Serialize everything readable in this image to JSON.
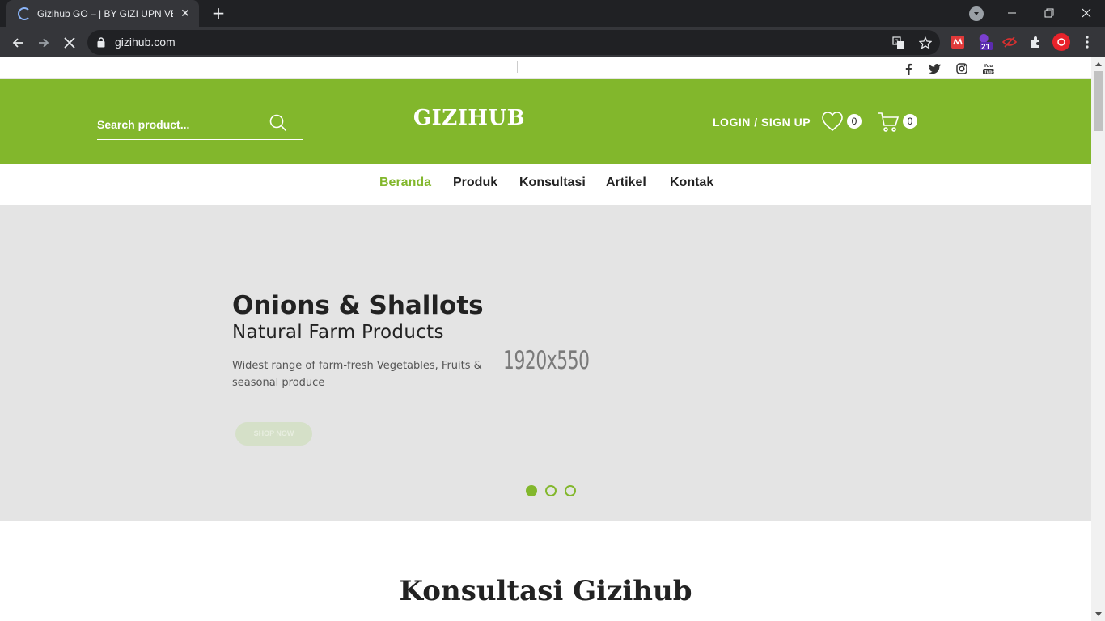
{
  "browser": {
    "tab_title": "Gizihub GO – | BY GIZI UPN VETERAN",
    "url": "gizihub.com",
    "extension_badge": "21"
  },
  "topbar": {
    "social": [
      "facebook-icon",
      "twitter-icon",
      "instagram-icon",
      "youtube-icon"
    ]
  },
  "header": {
    "search_placeholder": "Search product...",
    "logo": "GIZIHUB",
    "login_label": "LOGIN / SIGN UP",
    "wishlist_count": "0",
    "cart_count": "0",
    "bg_color": "#82b72c"
  },
  "nav": {
    "items": [
      {
        "label": "Beranda",
        "active": true
      },
      {
        "label": "Produk",
        "active": false
      },
      {
        "label": "Konsultasi",
        "active": false
      },
      {
        "label": "Artikel",
        "active": false
      },
      {
        "label": "Kontak",
        "active": false
      }
    ]
  },
  "hero": {
    "title": "Onions & Shallots",
    "subtitle": "Natural Farm Products",
    "description": "Widest range of farm-fresh Vegetables, Fruits & seasonal produce",
    "image_placeholder": "1920x550",
    "button_label": "SHOP NOW",
    "slides": 3,
    "active_slide": 1
  },
  "section": {
    "title": "Konsultasi Gizihub"
  }
}
